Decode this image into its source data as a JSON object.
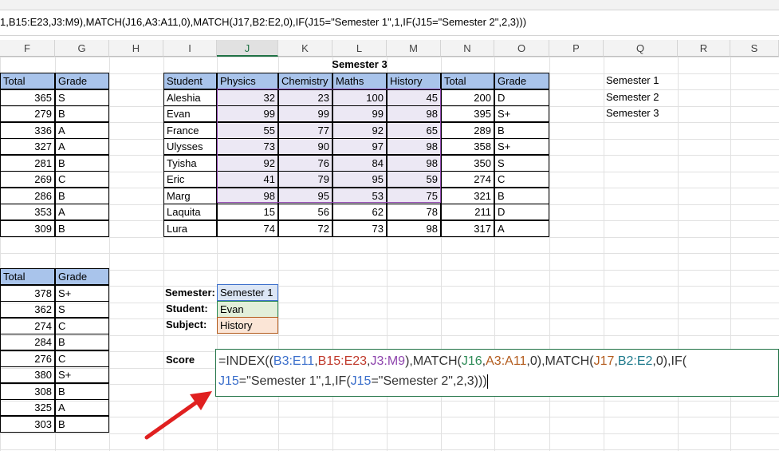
{
  "formula_bar": {
    "text": "1,B15:E23,J3:M9),MATCH(J16,A3:A11,0),MATCH(J17,B2:E2,0),IF(J15=\"Semester 1\",1,IF(J15=\"Semester 2\",2,3)))"
  },
  "columns": [
    "F",
    "G",
    "H",
    "I",
    "J",
    "K",
    "L",
    "M",
    "N",
    "O",
    "P",
    "Q",
    "R",
    "S"
  ],
  "semester3_title": "Semester 3",
  "left_table1": {
    "headers": [
      "Total",
      "Grade"
    ],
    "rows": [
      [
        "365",
        "S"
      ],
      [
        "279",
        "B"
      ],
      [
        "336",
        "A"
      ],
      [
        "327",
        "A"
      ],
      [
        "281",
        "B"
      ],
      [
        "269",
        "C"
      ],
      [
        "286",
        "B"
      ],
      [
        "353",
        "A"
      ],
      [
        "309",
        "B"
      ]
    ]
  },
  "left_table2": {
    "headers": [
      "Total",
      "Grade"
    ],
    "rows": [
      [
        "378",
        "S+"
      ],
      [
        "362",
        "S"
      ],
      [
        "274",
        "C"
      ],
      [
        "284",
        "B"
      ],
      [
        "276",
        "C"
      ],
      [
        "380",
        "S+"
      ],
      [
        "308",
        "B"
      ],
      [
        "325",
        "A"
      ],
      [
        "303",
        "B"
      ]
    ]
  },
  "main_table": {
    "headers": [
      "Student",
      "Physics",
      "Chemistry",
      "Maths",
      "History",
      "Total",
      "Grade"
    ],
    "rows": [
      [
        "Aleshia",
        "32",
        "23",
        "100",
        "45",
        "200",
        "D"
      ],
      [
        "Evan",
        "99",
        "99",
        "99",
        "98",
        "395",
        "S+"
      ],
      [
        "France",
        "55",
        "77",
        "92",
        "65",
        "289",
        "B"
      ],
      [
        "Ulysses",
        "73",
        "90",
        "97",
        "98",
        "358",
        "S+"
      ],
      [
        "Tyisha",
        "92",
        "76",
        "84",
        "98",
        "350",
        "S"
      ],
      [
        "Eric",
        "41",
        "79",
        "95",
        "59",
        "274",
        "C"
      ],
      [
        "Marg",
        "98",
        "95",
        "53",
        "75",
        "321",
        "B"
      ],
      [
        "Laquita",
        "15",
        "56",
        "62",
        "78",
        "211",
        "D"
      ],
      [
        "Lura",
        "74",
        "72",
        "73",
        "98",
        "317",
        "A"
      ]
    ]
  },
  "semester_list": [
    "Semester 1",
    "Semester 2",
    "Semester 3"
  ],
  "lookup": {
    "semester_label": "Semester:",
    "semester_value": "Semester 1",
    "student_label": "Student:",
    "student_value": "Evan",
    "subject_label": "Subject:",
    "subject_value": "History",
    "score_label": "Score"
  },
  "formula_parts": {
    "p1": "=INDEX((",
    "r1": "B3:E11",
    "c1": ",",
    "r2": "B15:E23",
    "c2": ",",
    "r3": "J3:M9",
    "p2": "),MATCH(",
    "r4": "J16",
    "c3": ",",
    "r5": "A3:A11",
    "p3": ",0),MATCH(",
    "r6": "J17",
    "c4": ",",
    "r7": "B2:E2",
    "p4": ",0),IF(",
    "r8": "J15",
    "p5": "=\"Semester 1\",1,IF(",
    "r9": "J15",
    "p6": "=\"Semester 2\",2,3)))"
  }
}
